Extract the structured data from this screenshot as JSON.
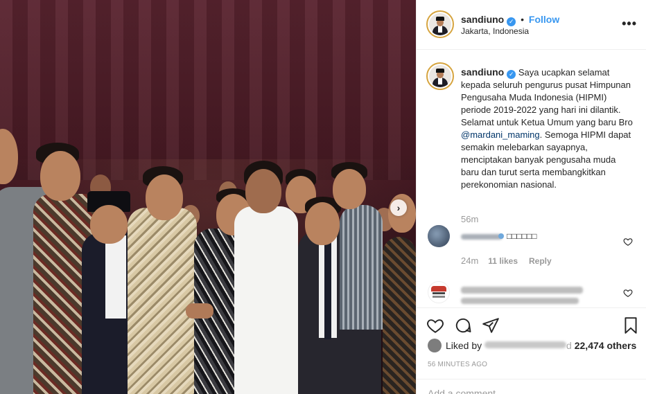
{
  "post": {
    "author": "sandiuno",
    "follow_label": "Follow",
    "dot": "•",
    "location": "Jakarta, Indonesia",
    "more_label": "•••",
    "verified_mark": "✓"
  },
  "caption": {
    "author": "sandiuno",
    "text_before_mention": "Saya ucapkan selamat kepada seluruh pengurus pusat Himpunan Pengusaha Muda Indonesia (HIPMI) periode 2019-2022 yang hari ini dilantik. Selamat untuk Ketua Umum yang baru Bro ",
    "mention": "@mardani_maming",
    "text_after_mention": ". Semoga HIPMI dapat semakin melebarkan sayapnya, menciptakan banyak pengusaha muda baru dan turut serta membangkitkan perekonomian nasional.",
    "time": "56m"
  },
  "comments": [
    {
      "text": "□□□□□□",
      "time": "24m",
      "likes": "11 likes",
      "reply_label": "Reply"
    }
  ],
  "likes": {
    "prefix": "Liked by",
    "suffix_pre": "and ",
    "count": "22,474 others"
  },
  "time_ago": "56 MINUTES AGO",
  "add_comment_placeholder": "Add a comment…",
  "carousel_next": "›",
  "colors": {
    "accent": "#3897f0",
    "mention": "#003569",
    "muted": "#999999",
    "border": "#efefef"
  }
}
